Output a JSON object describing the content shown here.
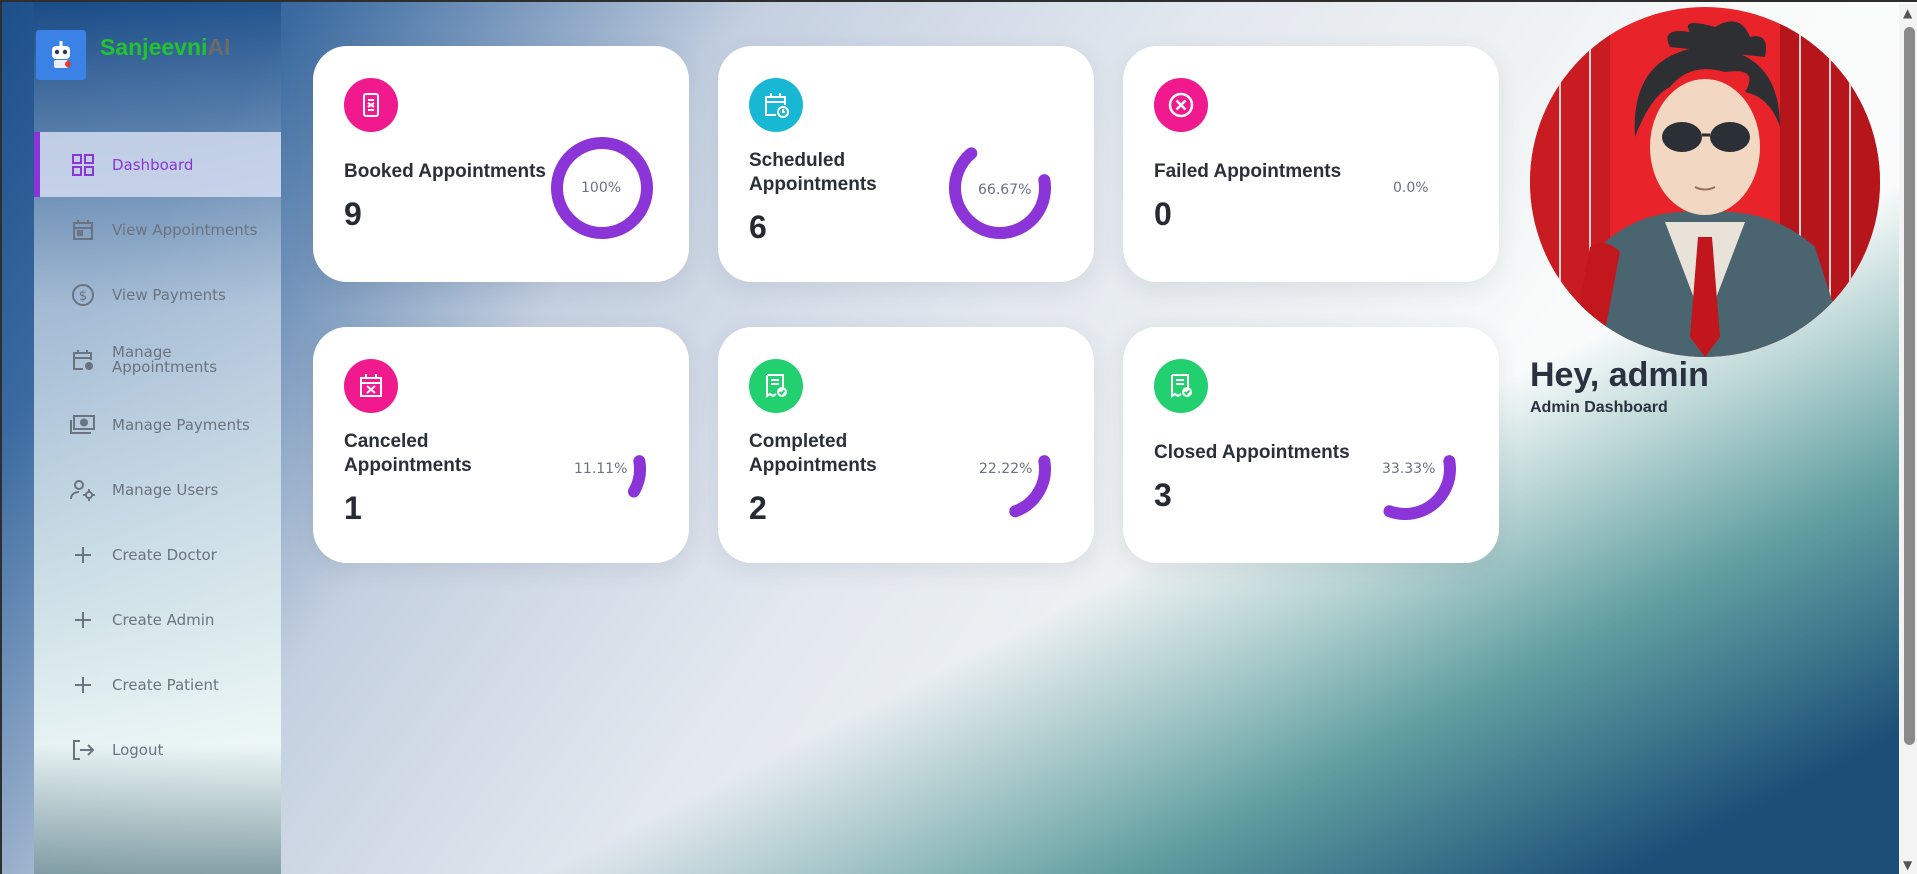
{
  "brand": {
    "name_part1": "Sanjeevni",
    "name_part2": "AI"
  },
  "sidebar": {
    "items": [
      {
        "label": "Dashboard",
        "icon": "dashboard-grid-icon",
        "active": true
      },
      {
        "label": "View Appointments",
        "icon": "calendar-icon",
        "active": false
      },
      {
        "label": "View Payments",
        "icon": "dollar-circle-icon",
        "active": false
      },
      {
        "label": "Manage Appointments",
        "icon": "calendar-clock-icon",
        "active": false
      },
      {
        "label": "Manage Payments",
        "icon": "money-bill-icon",
        "active": false
      },
      {
        "label": "Manage Users",
        "icon": "user-gear-icon",
        "active": false
      },
      {
        "label": "Create Doctor",
        "icon": "plus-icon",
        "active": false
      },
      {
        "label": "Create Admin",
        "icon": "plus-icon",
        "active": false
      },
      {
        "label": "Create Patient",
        "icon": "plus-icon",
        "active": false
      },
      {
        "label": "Logout",
        "icon": "logout-icon",
        "active": false
      }
    ]
  },
  "cards": [
    {
      "title": "Booked Appointments",
      "count": "9",
      "percent_label": "100%",
      "percent": 100,
      "icon": "booking-icon",
      "color": "#f0198e"
    },
    {
      "title": "Scheduled Appointments",
      "count": "6",
      "percent_label": "66.67%",
      "percent": 66.67,
      "icon": "calendar-clock-icon",
      "color": "#18b8d4"
    },
    {
      "title": "Failed Appointments",
      "count": "0",
      "percent_label": "0.0%",
      "percent": 0,
      "icon": "cancel-circle-icon",
      "color": "#f0198e"
    },
    {
      "title": "Canceled Appointments",
      "count": "1",
      "percent_label": "11.11%",
      "percent": 11.11,
      "icon": "calendar-x-icon",
      "color": "#f0198e"
    },
    {
      "title": "Completed Appointments",
      "count": "2",
      "percent_label": "22.22%",
      "percent": 22.22,
      "icon": "receipt-check-icon",
      "color": "#22d06f"
    },
    {
      "title": "Closed Appointments",
      "count": "3",
      "percent_label": "33.33%",
      "percent": 33.33,
      "icon": "receipt-check-icon",
      "color": "#22d06f"
    }
  ],
  "ring_color": "#8b34d8",
  "profile": {
    "greeting": "Hey, admin",
    "subtitle": "Admin Dashboard"
  }
}
